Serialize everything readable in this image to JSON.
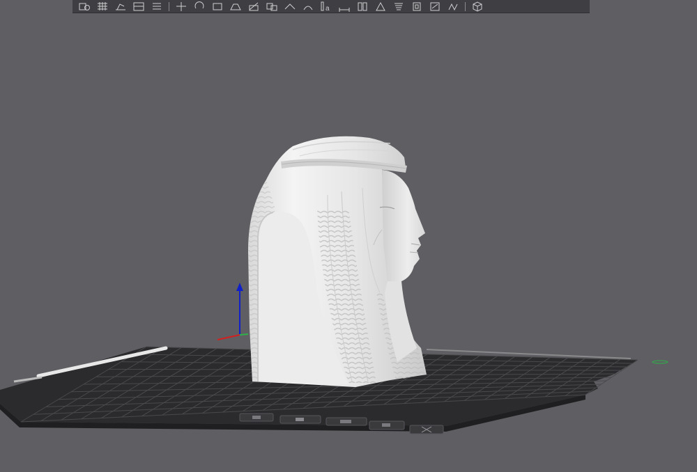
{
  "toolbar": {
    "buttons": [
      {
        "icon": "add-object-icon"
      },
      {
        "icon": "arrange-grid-icon"
      },
      {
        "icon": "lay-on-face-icon"
      },
      {
        "icon": "split-view-icon"
      },
      {
        "icon": "list-icon"
      },
      {
        "icon": "move-tool-icon"
      },
      {
        "icon": "rotate-tool-icon"
      },
      {
        "icon": "scale-tool-icon"
      },
      {
        "icon": "place-on-face-icon"
      },
      {
        "icon": "cut-tool-icon"
      },
      {
        "icon": "mesh-boolean-icon"
      },
      {
        "icon": "support-paint-icon"
      },
      {
        "icon": "seam-paint-icon"
      },
      {
        "icon": "text-tool-icon"
      },
      {
        "icon": "measure-icon"
      },
      {
        "icon": "assembly-icon"
      },
      {
        "icon": "brim-ears-icon"
      },
      {
        "icon": "variable-layer-icon"
      },
      {
        "icon": "hollow-icon"
      },
      {
        "icon": "color-paint-icon"
      },
      {
        "icon": "fuzzy-skin-icon"
      },
      {
        "icon": "view-cube-icon"
      }
    ],
    "text_tool_glyph": "a"
  },
  "bed_controls": [
    {
      "icon": "bed-orient-icon"
    },
    {
      "icon": "bed-lock-icon"
    },
    {
      "icon": "bed-auto-arrange-icon"
    },
    {
      "icon": "bed-settings-icon"
    },
    {
      "icon": "bed-remove-icon"
    }
  ],
  "colors": {
    "background": "#5f5e62",
    "plate": "#2b2b2e",
    "plate_grid": "#4a4a4d",
    "model": "#e8e8e8",
    "axis_x": "#d22020",
    "axis_y": "#2eb14a",
    "axis_z": "#1020c8"
  }
}
